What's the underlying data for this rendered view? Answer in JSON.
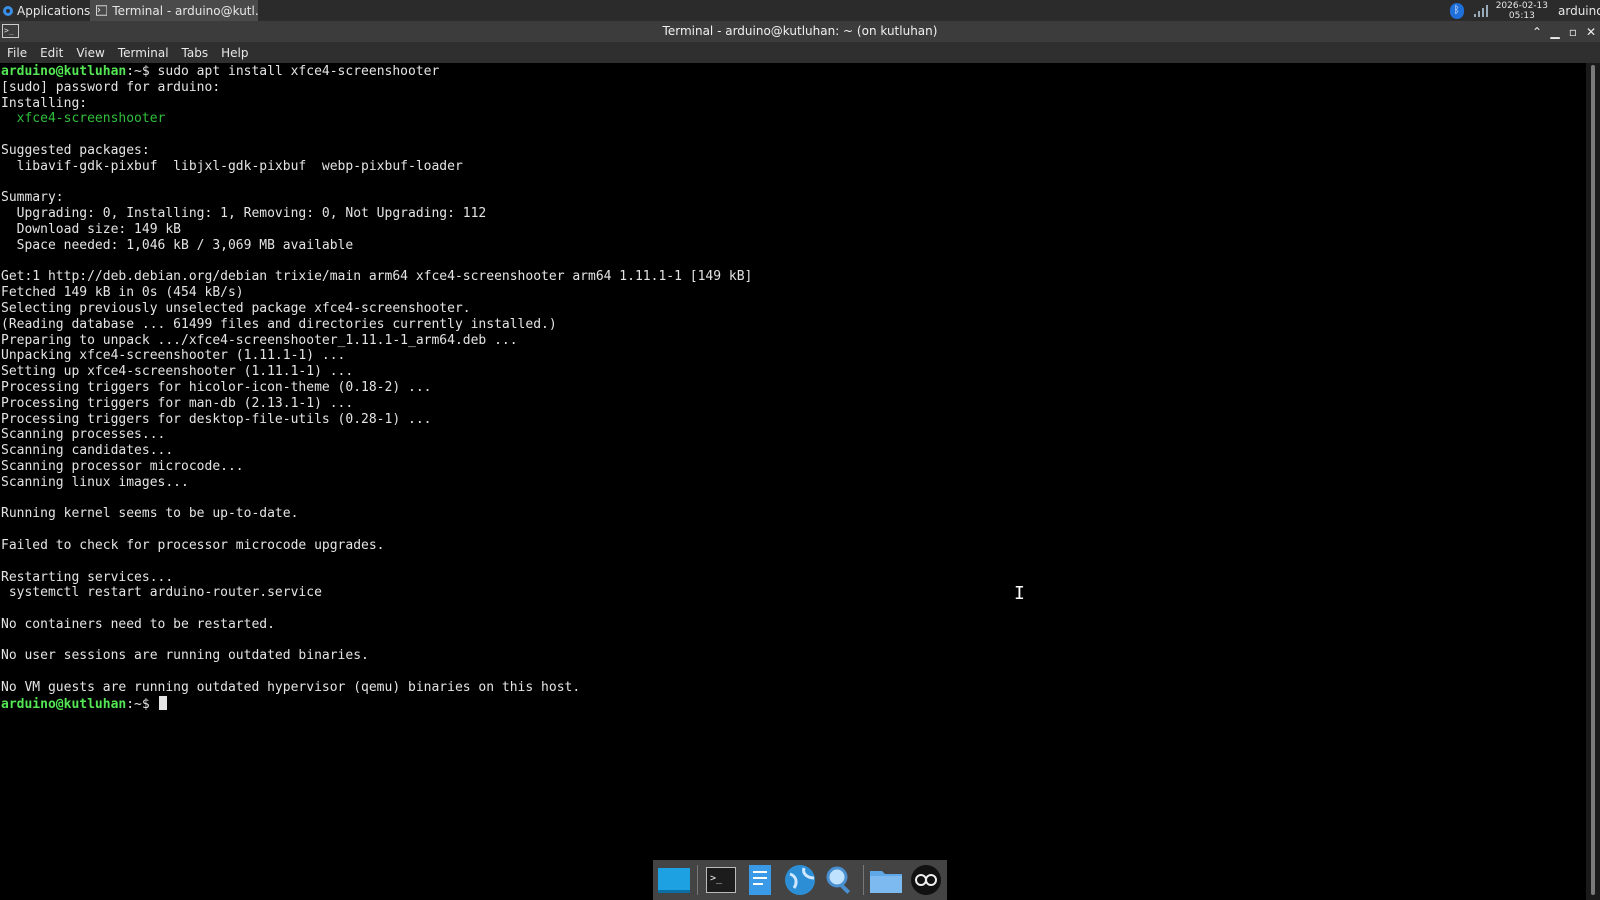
{
  "panel": {
    "applications_label": "Applications",
    "task_label": "Terminal - arduino@kutl...",
    "date": "2026-02-13",
    "time": "05:13",
    "user": "arduino"
  },
  "window": {
    "title": "Terminal - arduino@kutluhan: ~ (on kutluhan)"
  },
  "menu": [
    "File",
    "Edit",
    "View",
    "Terminal",
    "Tabs",
    "Help"
  ],
  "terminal": {
    "prompt_user": "arduino@kutluhan",
    "prompt_suffix": ":~$",
    "command": "sudo apt install xfce4-screenshooter",
    "lines_a": [
      "[sudo] password for arduino:",
      "Installing:"
    ],
    "installing_pkg": "  xfce4-screenshooter",
    "lines_b": [
      "",
      "Suggested packages:",
      "  libavif-gdk-pixbuf  libjxl-gdk-pixbuf  webp-pixbuf-loader",
      "",
      "Summary:",
      "  Upgrading: 0, Installing: 1, Removing: 0, Not Upgrading: 112",
      "  Download size: 149 kB",
      "  Space needed: 1,046 kB / 3,069 MB available",
      "",
      "Get:1 http://deb.debian.org/debian trixie/main arm64 xfce4-screenshooter arm64 1.11.1-1 [149 kB]",
      "Fetched 149 kB in 0s (454 kB/s)",
      "Selecting previously unselected package xfce4-screenshooter.",
      "(Reading database ... 61499 files and directories currently installed.)",
      "Preparing to unpack .../xfce4-screenshooter_1.11.1-1_arm64.deb ...",
      "Unpacking xfce4-screenshooter (1.11.1-1) ...",
      "Setting up xfce4-screenshooter (1.11.1-1) ...",
      "Processing triggers for hicolor-icon-theme (0.18-2) ...",
      "Processing triggers for man-db (2.13.1-1) ...",
      "Processing triggers for desktop-file-utils (0.28-1) ...",
      "Scanning processes...",
      "Scanning candidates...",
      "Scanning processor microcode...",
      "Scanning linux images...",
      "",
      "Running kernel seems to be up-to-date.",
      "",
      "Failed to check for processor microcode upgrades.",
      "",
      "Restarting services...",
      " systemctl restart arduino-router.service",
      "",
      "No containers need to be restarted.",
      "",
      "No user sessions are running outdated binaries.",
      "",
      "No VM guests are running outdated hypervisor (qemu) binaries on this host."
    ]
  },
  "dock": [
    "show-desktop-icon",
    "terminal-icon",
    "editor-icon",
    "browser-icon",
    "search-icon",
    "files-icon",
    "arduino-icon"
  ]
}
